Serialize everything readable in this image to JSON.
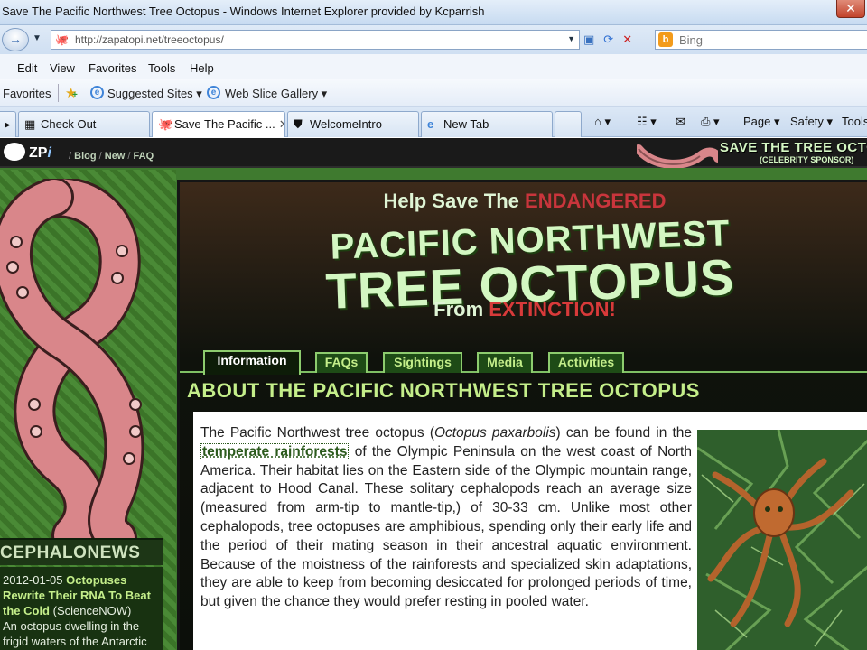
{
  "window": {
    "title": "Save The Pacific Northwest Tree Octopus - Windows Internet Explorer provided by Kcparrish",
    "close_label": "✕"
  },
  "address_bar": {
    "url": "http://zapatopi.net/treeoctopus/",
    "search_placeholder": "Bing"
  },
  "menu": [
    "Edit",
    "View",
    "Favorites",
    "Tools",
    "Help"
  ],
  "favorites_bar": {
    "favorites_label": "Favorites",
    "suggested_sites": "Suggested Sites ▾",
    "web_slice_gallery": "Web Slice Gallery ▾"
  },
  "tabs": [
    {
      "label": "Check Out"
    },
    {
      "label": "Save The Pacific ..."
    },
    {
      "label": "WelcomeIntro"
    },
    {
      "label": "New Tab"
    }
  ],
  "command_bar": {
    "page": "Page ▾",
    "safety": "Safety ▾",
    "tools": "Tools"
  },
  "site": {
    "logo_text": "ZP",
    "logo_i": "i",
    "nav": [
      "Blog",
      "New",
      "FAQ"
    ],
    "promo_main": "SAVE THE TREE OCTOPUS",
    "promo_sub": "(CELEBRITY SPONSOR)"
  },
  "hero": {
    "help_prefix": "Help Save The ",
    "help_highlight": "ENDANGERED",
    "line1": "PACIFIC NORTHWEST",
    "line2": "TREE OCTOPUS",
    "from_prefix": "From ",
    "from_highlight": "EXTINCTION!"
  },
  "page_tabs": [
    "Information",
    "FAQs",
    "Sightings",
    "Media",
    "Activities"
  ],
  "about_heading": "ABOUT THE PACIFIC NORTHWEST TREE OCTOPUS",
  "article": {
    "p1": "The Pacific Northwest tree octopus (",
    "species": "Octopus paxarbolis",
    "p2": ") can be found in the ",
    "link": "temperate rainforests",
    "p3": " of the Olympic Peninsula on the west coast of North America. Their habitat lies on the Eastern side of the Olympic mountain range, adjacent to Hood Canal. These solitary cephalopods reach an average size (measured from arm-tip to mantle-tip,) of 30-33 cm. Unlike most other cephalopods, tree octopuses are amphibious, spending only their early life and the period of their mating season in their ancestral aquatic environment. Because of the moistness of the rainforests and specialized skin adaptations, they are able to keep from becoming desiccated for prolonged periods of time, but given the chance they would prefer resting in pooled water."
  },
  "news": {
    "heading": "CEPHALONEWS",
    "date": "2012-01-05",
    "headline": "Octopuses Rewrite Their RNA To Beat the Cold",
    "source": "(ScienceNOW)",
    "snippet": "An octopus dwelling in the frigid waters of the Antarctic"
  },
  "colors": {
    "accent_green": "#c4ee8a",
    "tab_border": "#8dcc6e",
    "endangered_red": "#c9353c",
    "tentacle_pink": "#d9868a"
  }
}
